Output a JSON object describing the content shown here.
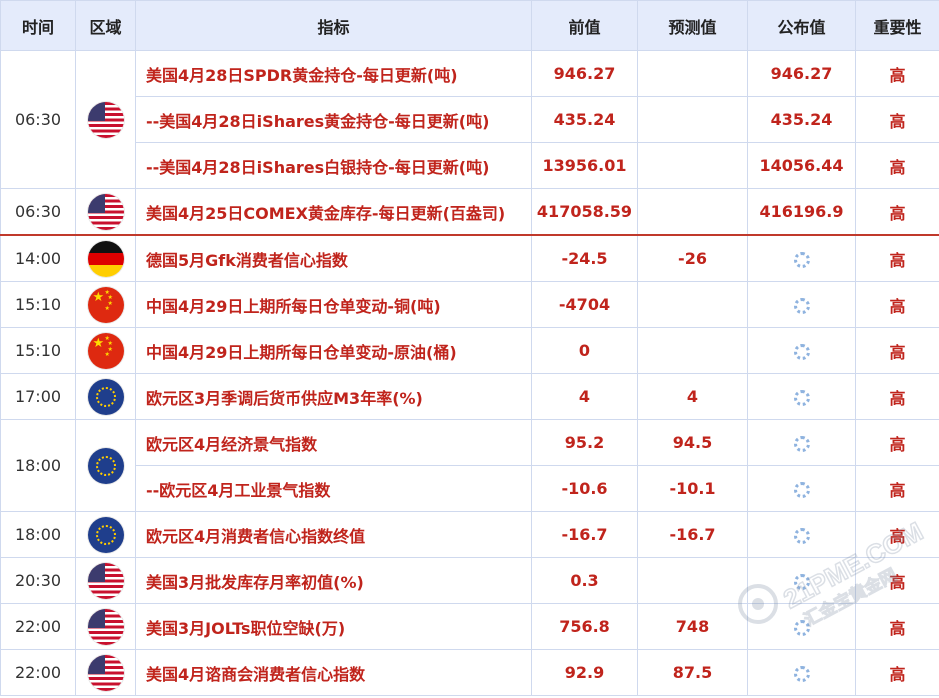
{
  "headers": {
    "time": "时间",
    "region": "区域",
    "indicator": "指标",
    "previous": "前值",
    "forecast": "预测值",
    "actual": "公布值",
    "importance": "重要性"
  },
  "rows": [
    {
      "time": "06:30",
      "flag": "us",
      "indicator": "美国4月28日SPDR黄金持仓-每日更新(吨)",
      "previous": "946.27",
      "forecast": "",
      "actual": "946.27",
      "importance": "高"
    },
    {
      "indicator": "--美国4月28日iShares黄金持仓-每日更新(吨)",
      "previous": "435.24",
      "forecast": "",
      "actual": "435.24",
      "importance": "高"
    },
    {
      "indicator": "--美国4月28日iShares白银持仓-每日更新(吨)",
      "previous": "13956.01",
      "forecast": "",
      "actual": "14056.44",
      "importance": "高"
    },
    {
      "time": "06:30",
      "flag": "us",
      "indicator": "美国4月25日COMEX黄金库存-每日更新(百盎司)",
      "previous": "417058.59",
      "forecast": "",
      "actual": "416196.9",
      "importance": "高"
    },
    {
      "time": "14:00",
      "flag": "de",
      "indicator": "德国5月Gfk消费者信心指数",
      "previous": "-24.5",
      "forecast": "-26",
      "actual": "",
      "importance": "高"
    },
    {
      "time": "15:10",
      "flag": "cn",
      "indicator": "中国4月29日上期所每日仓单变动-铜(吨)",
      "previous": "-4704",
      "forecast": "",
      "actual": "",
      "importance": "高"
    },
    {
      "time": "15:10",
      "flag": "cn",
      "indicator": "中国4月29日上期所每日仓单变动-原油(桶)",
      "previous": "0",
      "forecast": "",
      "actual": "",
      "importance": "高"
    },
    {
      "time": "17:00",
      "flag": "eu",
      "indicator": "欧元区3月季调后货币供应M3年率(%)",
      "previous": "4",
      "forecast": "4",
      "actual": "",
      "importance": "高"
    },
    {
      "time": "18:00",
      "flag": "eu",
      "indicator": "欧元区4月经济景气指数",
      "previous": "95.2",
      "forecast": "94.5",
      "actual": "",
      "importance": "高"
    },
    {
      "indicator": "--欧元区4月工业景气指数",
      "previous": "-10.6",
      "forecast": "-10.1",
      "actual": "",
      "importance": "高"
    },
    {
      "time": "18:00",
      "flag": "eu",
      "indicator": "欧元区4月消费者信心指数终值",
      "previous": "-16.7",
      "forecast": "-16.7",
      "actual": "",
      "importance": "高"
    },
    {
      "time": "20:30",
      "flag": "us",
      "indicator": "美国3月批发库存月率初值(%)",
      "previous": "0.3",
      "forecast": "",
      "actual": "",
      "importance": "高"
    },
    {
      "time": "22:00",
      "flag": "us",
      "indicator": "美国3月JOLTs职位空缺(万)",
      "previous": "756.8",
      "forecast": "748",
      "actual": "",
      "importance": "高"
    },
    {
      "time": "22:00",
      "flag": "us",
      "indicator": "美国4月谘商会消费者信心指数",
      "previous": "92.9",
      "forecast": "87.5",
      "actual": "",
      "importance": "高"
    }
  ],
  "watermark": {
    "brand": "21PME.COM",
    "tagline": "汇金宝黄金网"
  },
  "colors": {
    "header_bg": "#e4ebfb",
    "accent_red": "#c0241c",
    "border": "#cfd9ee",
    "divider": "#c0392b"
  }
}
